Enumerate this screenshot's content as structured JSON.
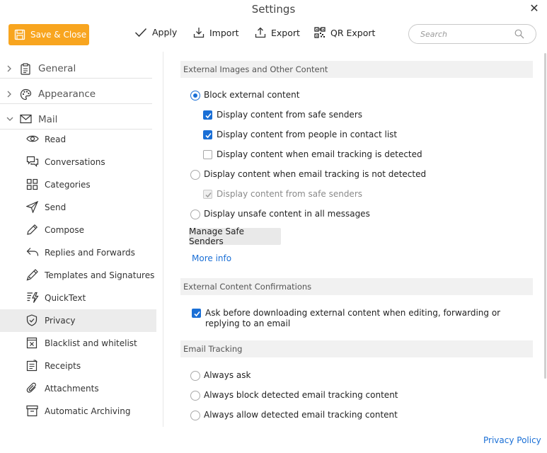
{
  "window": {
    "title": "Settings"
  },
  "toolbar": {
    "save_close": "Save & Close",
    "apply": "Apply",
    "import": "Import",
    "export": "Export",
    "qr_export": "QR Export",
    "search_placeholder": "Search"
  },
  "sidebar": {
    "sections": [
      {
        "label": "General",
        "expanded": false
      },
      {
        "label": "Appearance",
        "expanded": false
      },
      {
        "label": "Mail",
        "expanded": true
      }
    ],
    "mail_items": [
      {
        "label": "Read",
        "icon": "eye-icon"
      },
      {
        "label": "Conversations",
        "icon": "conversations-icon"
      },
      {
        "label": "Categories",
        "icon": "categories-icon"
      },
      {
        "label": "Send",
        "icon": "send-icon"
      },
      {
        "label": "Compose",
        "icon": "pencil-icon"
      },
      {
        "label": "Replies and Forwards",
        "icon": "reply-icon"
      },
      {
        "label": "Templates and Signatures",
        "icon": "signature-icon"
      },
      {
        "label": "QuickText",
        "icon": "quicktext-icon"
      },
      {
        "label": "Privacy",
        "icon": "shield-icon",
        "selected": true
      },
      {
        "label": "Blacklist and whitelist",
        "icon": "blacklist-icon"
      },
      {
        "label": "Receipts",
        "icon": "receipt-icon"
      },
      {
        "label": "Attachments",
        "icon": "paperclip-icon"
      },
      {
        "label": "Automatic Archiving",
        "icon": "archive-icon"
      }
    ]
  },
  "content": {
    "external_images": {
      "heading": "External Images and Other Content",
      "block_external": {
        "label": "Block external content",
        "checked": true
      },
      "safe_senders": {
        "label": "Display content from safe senders",
        "checked": true
      },
      "contact_list": {
        "label": "Display content from people in contact list",
        "checked": true
      },
      "tracking_detected": {
        "label": "Display content when email tracking is detected",
        "checked": false
      },
      "tracking_not_detected": {
        "label": "Display content when email tracking is not detected",
        "checked": false
      },
      "safe_senders_disabled": {
        "label": "Display content from safe senders",
        "checked": true,
        "disabled": true
      },
      "unsafe_all": {
        "label": "Display unsafe content in all messages",
        "checked": false
      },
      "manage_button": "Manage Safe Senders",
      "more_info": "More info"
    },
    "confirmations": {
      "heading": "External Content Confirmations",
      "ask_before": {
        "label": "Ask before downloading external content when editing, forwarding or replying to an email",
        "checked": true
      }
    },
    "tracking": {
      "heading": "Email Tracking",
      "always_ask": "Always ask",
      "always_block": "Always block detected email tracking content",
      "always_allow": "Always allow detected email tracking content"
    },
    "privacy_policy": "Privacy Policy"
  },
  "colors": {
    "accent": "#1a6fd6",
    "save_button": "#f8a51f",
    "selected_row": "#ececec"
  }
}
